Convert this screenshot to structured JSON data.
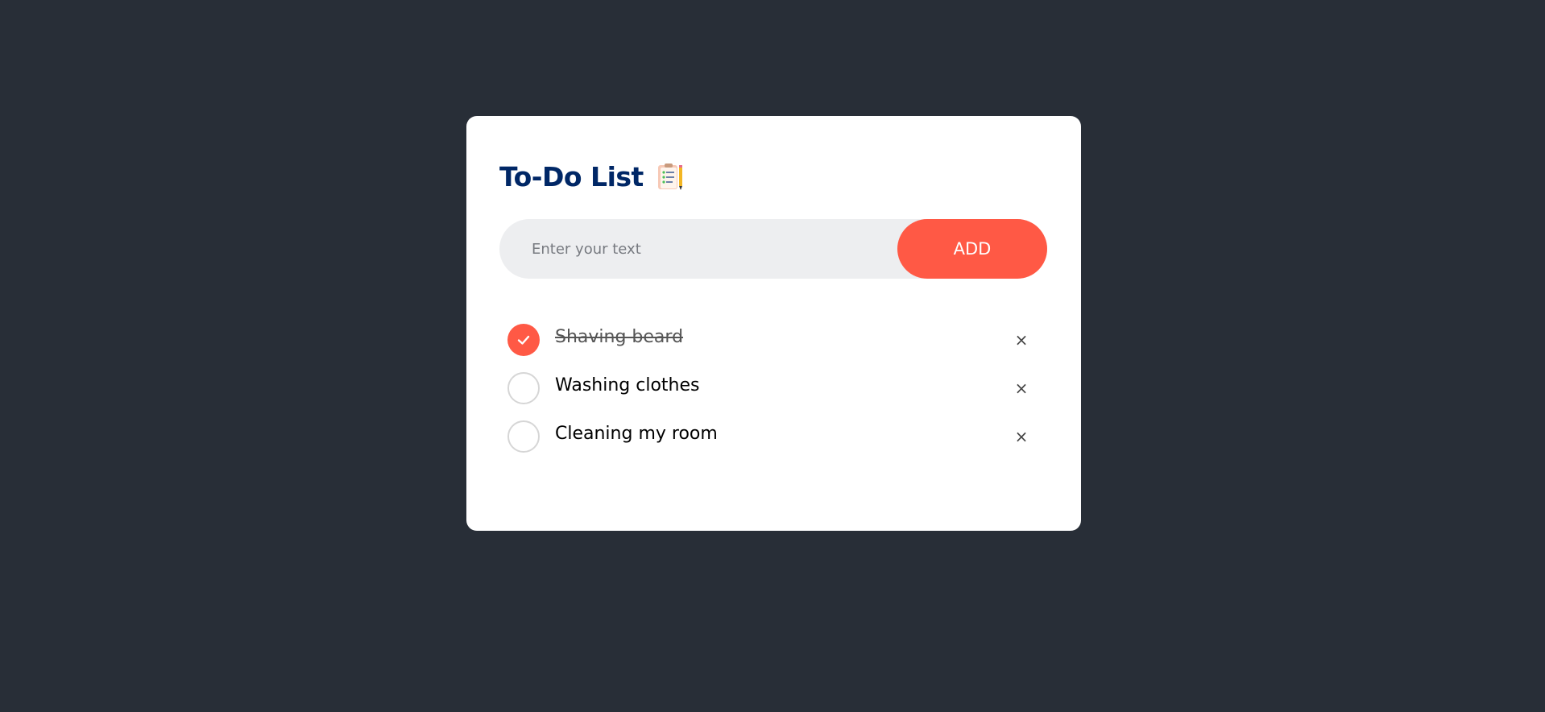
{
  "app": {
    "title": "To-Do List",
    "title_icon": "clipboard-checklist-icon"
  },
  "input": {
    "placeholder": "Enter your text",
    "value": "",
    "add_label": "ADD"
  },
  "tasks": [
    {
      "text": "Shaving beard",
      "done": true
    },
    {
      "text": "Washing clothes",
      "done": false
    },
    {
      "text": "Cleaning my room",
      "done": false
    }
  ],
  "icons": {
    "checked": "checkmark-icon",
    "delete": "close-icon",
    "delete_glyph": "×"
  },
  "colors": {
    "background": "#282e37",
    "card": "#ffffff",
    "title": "#002766",
    "accent": "#ff5945",
    "input_bg": "#edeef0"
  }
}
